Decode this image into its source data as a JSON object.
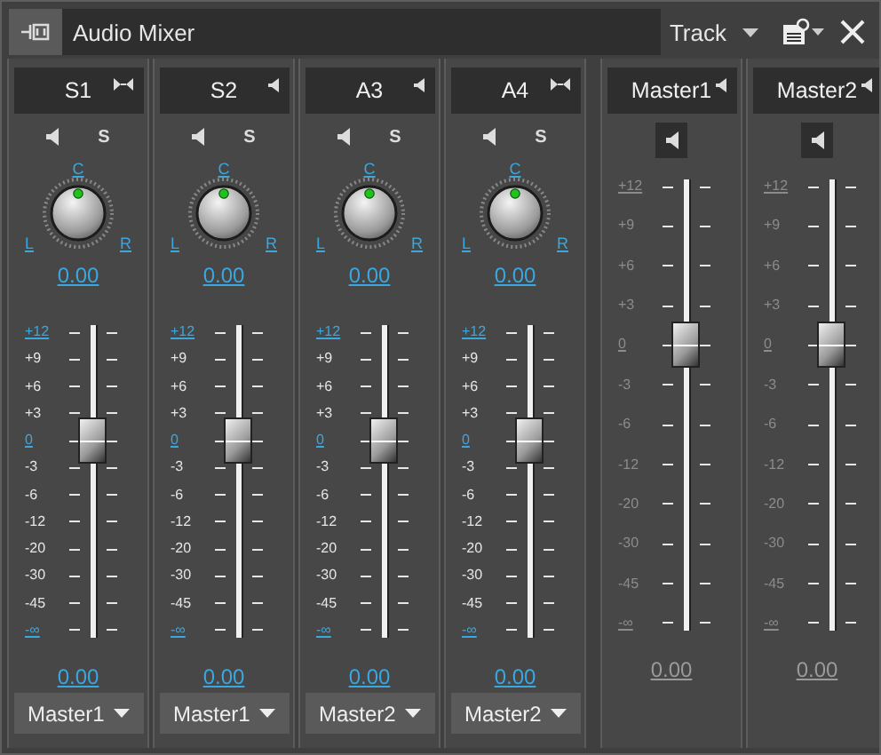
{
  "window": {
    "title": "Audio Mixer"
  },
  "toolbar": {
    "view_label": "Track"
  },
  "strips": [
    {
      "kind": "track",
      "name": "S1",
      "header_icon": {
        "kind": "stereo"
      },
      "solo_label": "S",
      "pan": {
        "center": "C",
        "left": "L",
        "right": "R",
        "value": "0.00"
      },
      "level": 0.64,
      "volume": "0.00",
      "output": "Master1",
      "scale": [
        {
          "label": "+12",
          "major": true
        },
        {
          "label": "+9",
          "major": false
        },
        {
          "label": "+6",
          "major": false
        },
        {
          "label": "+3",
          "major": false
        },
        {
          "label": "0",
          "major": true
        },
        {
          "label": "-3",
          "major": false
        },
        {
          "label": "-6",
          "major": false
        },
        {
          "label": "-12",
          "major": false
        },
        {
          "label": "-20",
          "major": false
        },
        {
          "label": "-30",
          "major": false
        },
        {
          "label": "-45",
          "major": false
        },
        {
          "label": "-∞",
          "major": true
        }
      ]
    },
    {
      "kind": "track",
      "name": "S2",
      "header_icon": {
        "kind": "mono"
      },
      "solo_label": "S",
      "pan": {
        "center": "C",
        "left": "L",
        "right": "R",
        "value": "0.00"
      },
      "level": 0.64,
      "volume": "0.00",
      "output": "Master1",
      "scale": [
        {
          "label": "+12",
          "major": true
        },
        {
          "label": "+9",
          "major": false
        },
        {
          "label": "+6",
          "major": false
        },
        {
          "label": "+3",
          "major": false
        },
        {
          "label": "0",
          "major": true
        },
        {
          "label": "-3",
          "major": false
        },
        {
          "label": "-6",
          "major": false
        },
        {
          "label": "-12",
          "major": false
        },
        {
          "label": "-20",
          "major": false
        },
        {
          "label": "-30",
          "major": false
        },
        {
          "label": "-45",
          "major": false
        },
        {
          "label": "-∞",
          "major": true
        }
      ]
    },
    {
      "kind": "track",
      "name": "A3",
      "header_icon": {
        "kind": "mono"
      },
      "solo_label": "S",
      "pan": {
        "center": "C",
        "left": "L",
        "right": "R",
        "value": "0.00"
      },
      "level": 0.64,
      "volume": "0.00",
      "output": "Master2",
      "scale": [
        {
          "label": "+12",
          "major": true
        },
        {
          "label": "+9",
          "major": false
        },
        {
          "label": "+6",
          "major": false
        },
        {
          "label": "+3",
          "major": false
        },
        {
          "label": "0",
          "major": true
        },
        {
          "label": "-3",
          "major": false
        },
        {
          "label": "-6",
          "major": false
        },
        {
          "label": "-12",
          "major": false
        },
        {
          "label": "-20",
          "major": false
        },
        {
          "label": "-30",
          "major": false
        },
        {
          "label": "-45",
          "major": false
        },
        {
          "label": "-∞",
          "major": true
        }
      ]
    },
    {
      "kind": "track",
      "name": "A4",
      "header_icon": {
        "kind": "stereo"
      },
      "solo_label": "S",
      "pan": {
        "center": "C",
        "left": "L",
        "right": "R",
        "value": "0.00"
      },
      "level": 0.64,
      "volume": "0.00",
      "output": "Master2",
      "scale": [
        {
          "label": "+12",
          "major": true
        },
        {
          "label": "+9",
          "major": false
        },
        {
          "label": "+6",
          "major": false
        },
        {
          "label": "+3",
          "major": false
        },
        {
          "label": "0",
          "major": true
        },
        {
          "label": "-3",
          "major": false
        },
        {
          "label": "-6",
          "major": false
        },
        {
          "label": "-12",
          "major": false
        },
        {
          "label": "-20",
          "major": false
        },
        {
          "label": "-30",
          "major": false
        },
        {
          "label": "-45",
          "major": false
        },
        {
          "label": "-∞",
          "major": true
        }
      ]
    },
    {
      "kind": "master",
      "name": "Master1",
      "header_icon": {
        "kind": "mono"
      },
      "level": 0.64,
      "volume": "0.00",
      "scale": [
        {
          "label": "+12",
          "major": true
        },
        {
          "label": "+9",
          "major": false
        },
        {
          "label": "+6",
          "major": false
        },
        {
          "label": "+3",
          "major": false
        },
        {
          "label": "0",
          "major": true
        },
        {
          "label": "-3",
          "major": false
        },
        {
          "label": "-6",
          "major": false
        },
        {
          "label": "-12",
          "major": false
        },
        {
          "label": "-20",
          "major": false
        },
        {
          "label": "-30",
          "major": false
        },
        {
          "label": "-45",
          "major": false
        },
        {
          "label": "-∞",
          "major": true
        }
      ]
    },
    {
      "kind": "master",
      "name": "Master2",
      "header_icon": {
        "kind": "mono"
      },
      "level": 0.64,
      "volume": "0.00",
      "scale": [
        {
          "label": "+12",
          "major": true
        },
        {
          "label": "+9",
          "major": false
        },
        {
          "label": "+6",
          "major": false
        },
        {
          "label": "+3",
          "major": false
        },
        {
          "label": "0",
          "major": true
        },
        {
          "label": "-3",
          "major": false
        },
        {
          "label": "-6",
          "major": false
        },
        {
          "label": "-12",
          "major": false
        },
        {
          "label": "-20",
          "major": false
        },
        {
          "label": "-30",
          "major": false
        },
        {
          "label": "-45",
          "major": false
        },
        {
          "label": "-∞",
          "major": true
        }
      ]
    }
  ]
}
